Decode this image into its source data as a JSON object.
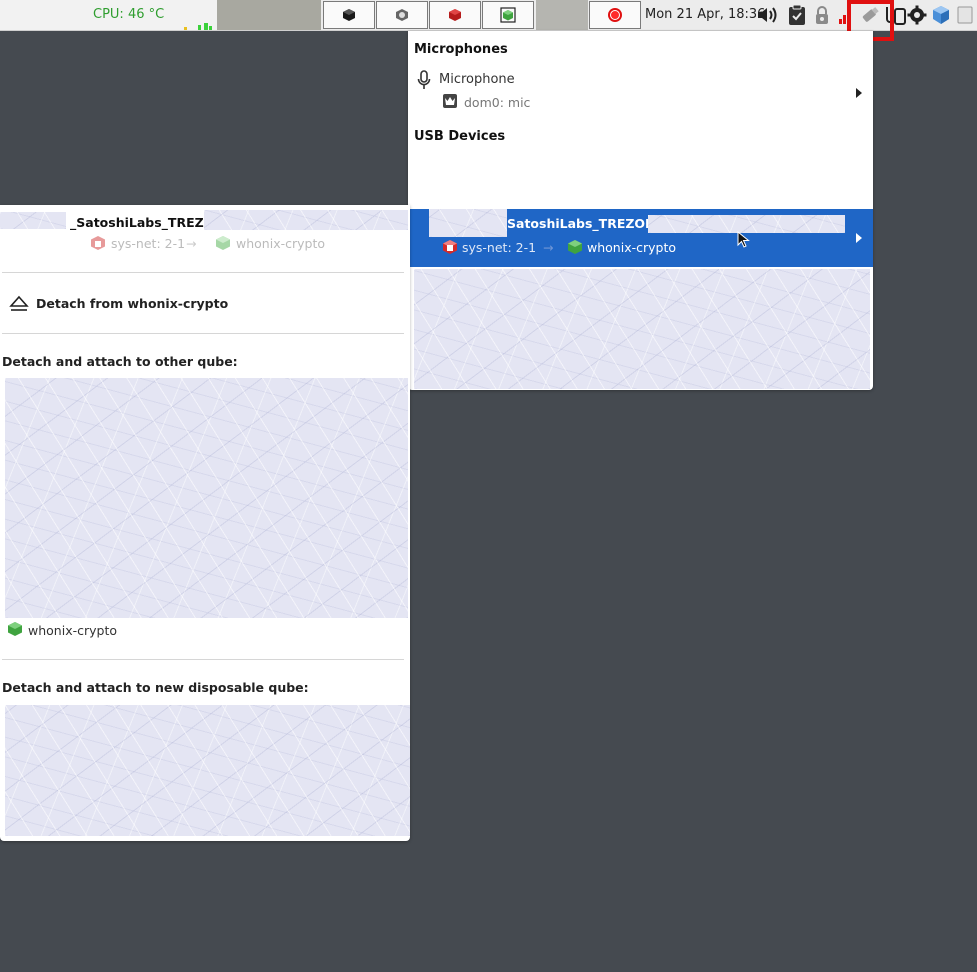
{
  "panel": {
    "cpu_label": "CPU: 46 °C",
    "clock": "Mon 21 Apr, 18:36",
    "tasks": [
      {
        "icon": "black-cube-icon",
        "color": "#1a1a1a"
      },
      {
        "icon": "gear-cube-icon",
        "color": "#555555"
      },
      {
        "icon": "red-cube-icon",
        "color": "#c41e1e"
      },
      {
        "icon": "green-cube-icon",
        "color": "#3fa33f"
      },
      {
        "icon": "record-icon",
        "color": "#e01010"
      }
    ],
    "tray": [
      "volume-icon",
      "clipboard-icon",
      "lock-icon",
      "network-icon",
      "usb-devices-icon",
      "phone-icon",
      "settings-icon",
      "qube-icon",
      "window-icon"
    ]
  },
  "menu": {
    "microphones_title": "Microphones",
    "microphone_label": "Microphone",
    "microphone_source": "dom0: mic",
    "usb_title": "USB Devices",
    "usb_device_name": "SatoshiLabs_TREZOR_",
    "usb_device_backend": "sys-net: 2-1",
    "usb_device_arrow": "→",
    "usb_device_attached": "whonix-crypto"
  },
  "submenu": {
    "device_title": "_SatoshiLabs_TREZOR",
    "backend": "sys-net: 2-1",
    "arrow": "→",
    "attached": "whonix-crypto",
    "detach_label": "Detach from whonix-crypto",
    "attach_other_title": "Detach and attach to other qube:",
    "other_qube_option": "whonix-crypto",
    "attach_disposable_title": "Detach and attach to new disposable qube:"
  },
  "colors": {
    "accent": "#1f66c6",
    "cpu_text": "#2f9e2f",
    "highlight": "#e01010",
    "desktop": "#454a50"
  }
}
